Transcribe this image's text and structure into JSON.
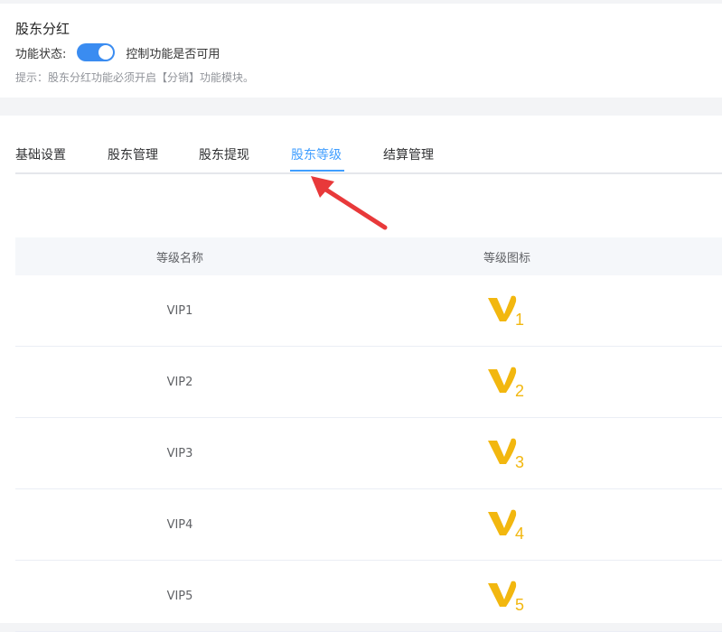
{
  "header": {
    "title": "股东分红",
    "status_label": "功能状态:",
    "toggle_on": true,
    "toggle_desc": "控制功能是否可用",
    "hint": "提示：股东分红功能必须开启【分销】功能模块。"
  },
  "tabs": [
    {
      "label": "基础设置",
      "active": false
    },
    {
      "label": "股东管理",
      "active": false
    },
    {
      "label": "股东提现",
      "active": false
    },
    {
      "label": "股东等级",
      "active": true
    },
    {
      "label": "结算管理",
      "active": false
    }
  ],
  "table": {
    "columns": [
      "等级名称",
      "等级图标"
    ],
    "rows": [
      {
        "name": "VIP1",
        "level": "1"
      },
      {
        "name": "VIP2",
        "level": "2"
      },
      {
        "name": "VIP3",
        "level": "3"
      },
      {
        "name": "VIP4",
        "level": "4"
      },
      {
        "name": "VIP5",
        "level": "5"
      }
    ]
  },
  "colors": {
    "accent": "#409eff",
    "toggle": "#3a8cf1",
    "badge_gold": "#f2b70f",
    "arrow": "#e8393a"
  }
}
